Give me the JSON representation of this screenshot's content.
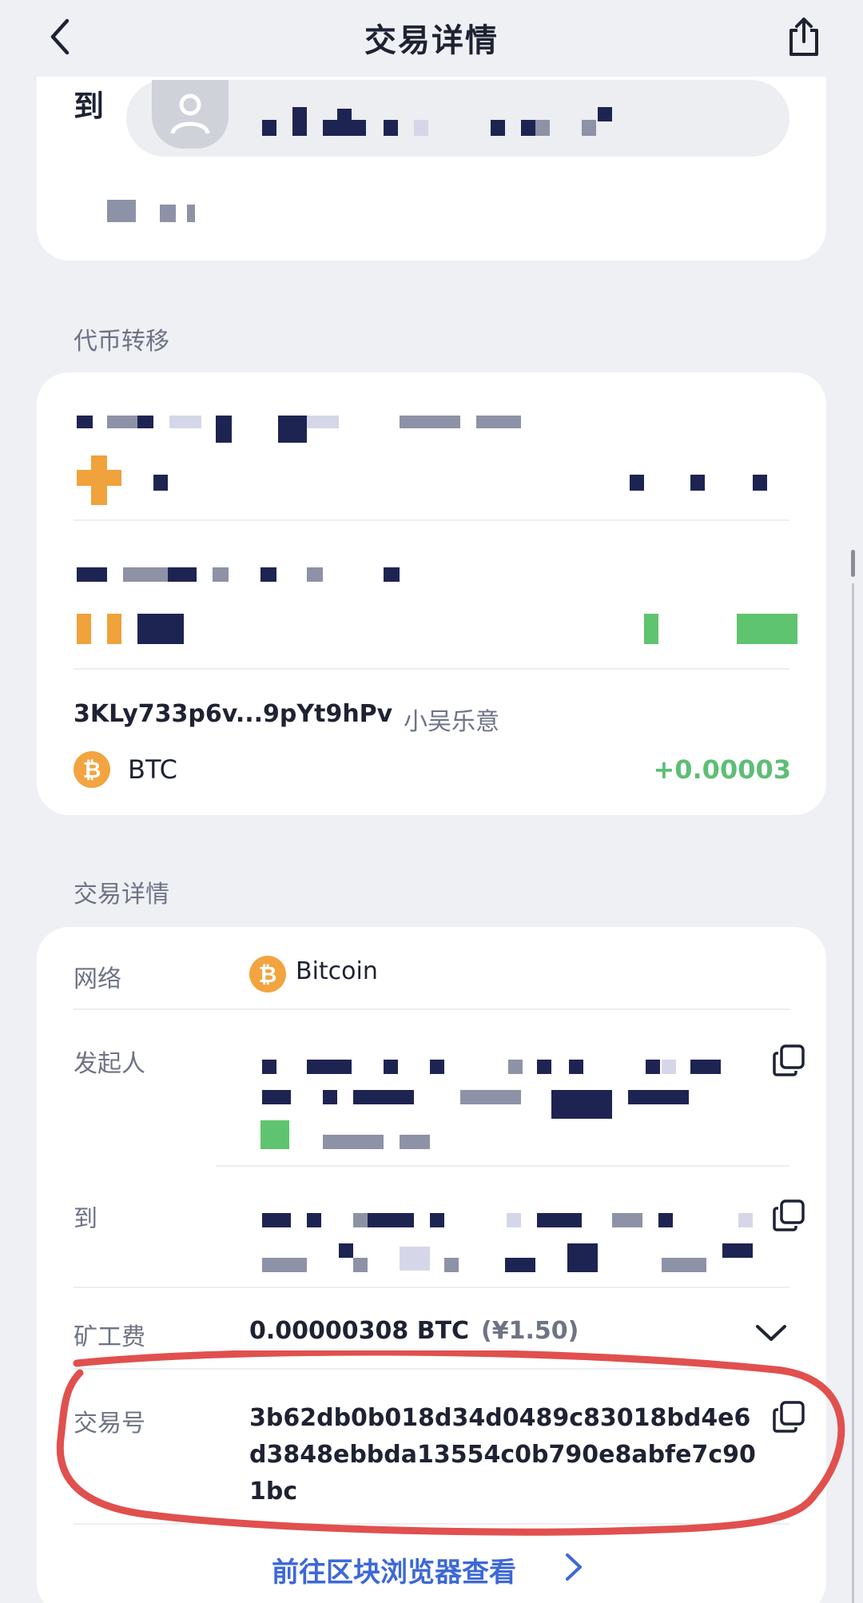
{
  "header": {
    "title": "交易详情",
    "back_icon": "chevron-left-icon",
    "share_icon": "share-icon"
  },
  "recipient_card": {
    "to_label": "到"
  },
  "token_transfer": {
    "section_label": "代币转移",
    "address": "3KLy733p6v...9pYt9hPv",
    "address_name": "小吴乐意",
    "token": "BTC",
    "token_icon_glyph": "₿",
    "amount": "+0.00003",
    "amount_color": "#5fbd76"
  },
  "details": {
    "section_label": "交易详情",
    "network_label": "网络",
    "network_value": "Bitcoin",
    "network_icon_glyph": "₿",
    "sender_label": "发起人",
    "to_label": "到",
    "fee_label": "矿工费",
    "fee_value": "0.00000308 BTC",
    "fee_fiat": "(¥1.50)",
    "txid_label": "交易号",
    "txid_value": "3b62db0b018d34d0489c83018bd4e6d3848ebbda13554c0b790e8abfe7c901bc",
    "explorer_link": "前往区块浏览器查看"
  },
  "colors": {
    "background": "#eef0f4",
    "link": "#3d68d6",
    "btc_orange": "#f2a440",
    "annotation_red": "#e0504e"
  }
}
